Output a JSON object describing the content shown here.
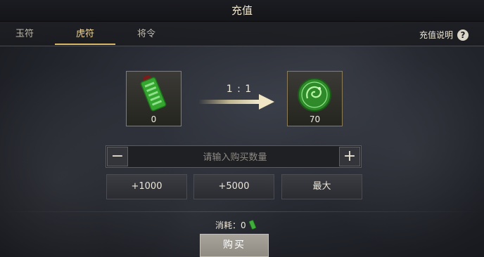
{
  "window": {
    "title": "充值"
  },
  "tabs": [
    {
      "label": "玉符",
      "active": false
    },
    {
      "label": "虎符",
      "active": true
    },
    {
      "label": "将令",
      "active": false
    }
  ],
  "help": {
    "label": "充值说明",
    "icon": "question-icon",
    "glyph": "?"
  },
  "exchange": {
    "ratio": "1 : 1",
    "from": {
      "icon": "jade-token-icon",
      "count": "0"
    },
    "to": {
      "icon": "tiger-seal-icon",
      "count": "70"
    }
  },
  "quantity": {
    "placeholder": "请输入购买数量",
    "value": "",
    "minus_glyph": "−",
    "plus_glyph": "+"
  },
  "quick_buttons": [
    "+1000",
    "+5000",
    "最大"
  ],
  "cost": {
    "label": "消耗：",
    "value": "0",
    "icon": "jade-token-icon"
  },
  "buy_button": {
    "label": "购买"
  },
  "colors": {
    "accent": "#d9b868",
    "jade": "#3fae3a",
    "frame": "#8c7d58"
  }
}
